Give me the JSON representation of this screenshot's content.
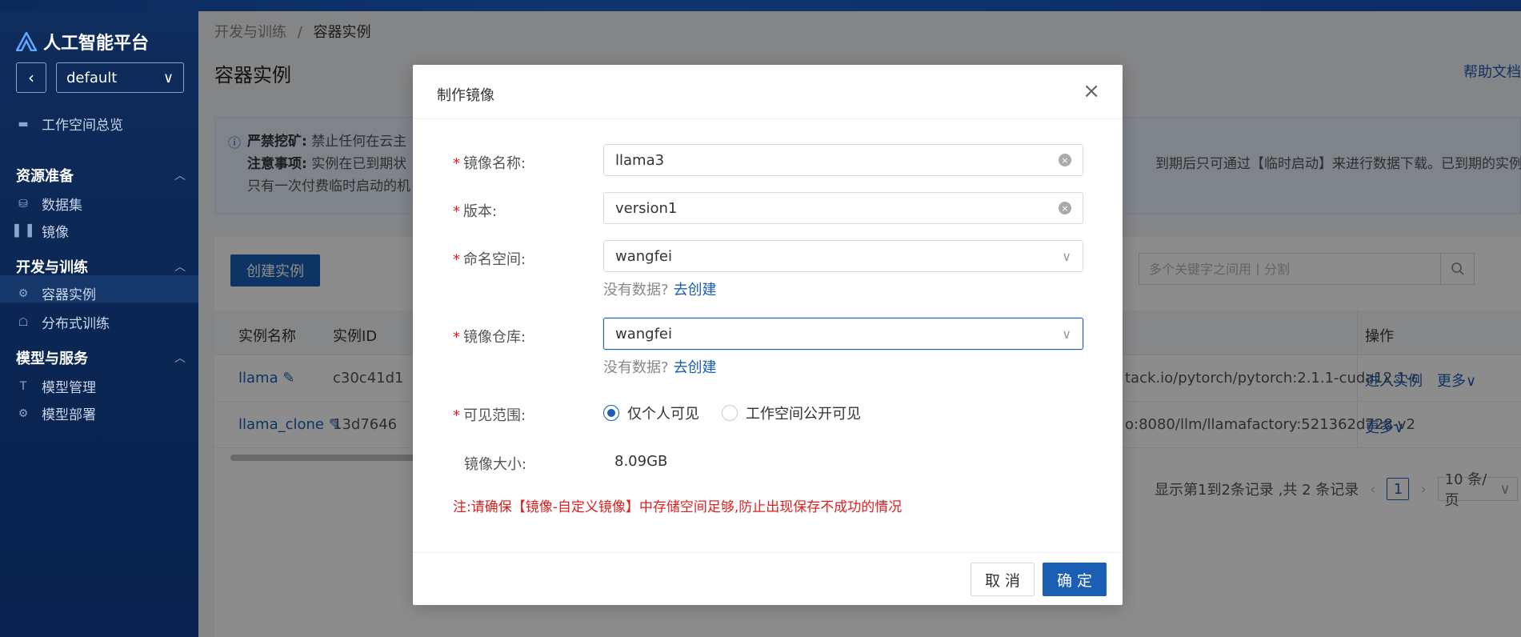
{
  "sidebar": {
    "brand": "人工智能平台",
    "workspace": "default",
    "overview": "工作空间总览",
    "groups": [
      {
        "title": "资源准备",
        "items": [
          "数据集",
          "镜像"
        ]
      },
      {
        "title": "开发与训练",
        "items": [
          "容器实例",
          "分布式训练"
        ]
      },
      {
        "title": "模型与服务",
        "items": [
          "模型管理",
          "模型部署"
        ]
      }
    ]
  },
  "breadcrumb": {
    "parent": "开发与训练",
    "sep": "/",
    "current": "容器实例"
  },
  "page": {
    "title": "容器实例",
    "help": "帮助文档",
    "notice": {
      "l1_label": "严禁挖矿:",
      "l1_text": "禁止任何在云主",
      "l2_label": "注意事项:",
      "l2_text": "实例在已到期状",
      "l2_right": "到期后只可通过【临时启动】来进行数据下载。已到期的实例",
      "l3_text": "只有一次付费临时启动的机"
    },
    "create_btn": "创建实例",
    "search_placeholder": "多个关键字之间用丨分割",
    "columns": {
      "name": "实例名称",
      "id": "实例ID",
      "ops": "操作"
    },
    "rows": [
      {
        "name": "llama",
        "id": "c30c41d1",
        "image": "tack.io/pytorch/pytorch:2.1.1-cuda12.1-c",
        "op1": "进入实例",
        "op2": "更多∨"
      },
      {
        "name": "llama_clone",
        "id": "13d7646",
        "image": "o:8080/llm/llamafactory:521362d728-v2",
        "op1": "",
        "op2": "更多∨"
      }
    ],
    "pager": {
      "summary": "显示第1到2条记录 ,共 2 条记录",
      "page": "1",
      "size": "10 条/页"
    }
  },
  "modal": {
    "title": "制作镜像",
    "fields": {
      "name_label": "镜像名称:",
      "name_value": "llama3",
      "version_label": "版本:",
      "version_value": "version1",
      "ns_label": "命名空间:",
      "ns_value": "wangfei",
      "repo_label": "镜像仓库:",
      "repo_value": "wangfei",
      "visibility_label": "可见范围:",
      "vis_private": "仅个人可见",
      "vis_public": "工作空间公开可见",
      "size_label": "镜像大小:",
      "size_value": "8.09GB"
    },
    "hint_text": "没有数据?",
    "hint_link": "去创建",
    "warning": "注:请确保【镜像-自定义镜像】中存储空间足够,防止出现保存不成功的情况",
    "cancel": "取 消",
    "ok": "确 定"
  },
  "colors": {
    "primary": "#1a5fb4",
    "required": "#e02020",
    "sidebar": "#0e2c5c"
  }
}
